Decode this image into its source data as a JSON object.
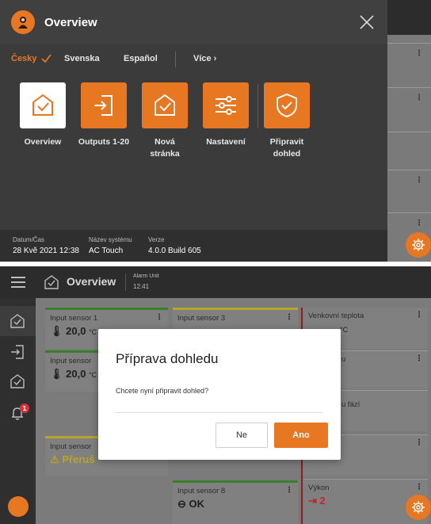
{
  "menu": {
    "title": "Overview",
    "languages": [
      {
        "label": "Česky",
        "selected": true
      },
      {
        "label": "Svenska"
      },
      {
        "label": "Español"
      },
      {
        "label": "Více  ›"
      }
    ],
    "tiles": [
      {
        "label": "Overview",
        "active": true
      },
      {
        "label": "Outputs 1-20"
      },
      {
        "label": "Nová\nstránka"
      },
      {
        "label": "Nastavení"
      },
      {
        "label": "Připravit\ndohled"
      }
    ],
    "footer": {
      "datetime_label": "Datum/Čas",
      "datetime_value": "28 Kvě 2021 12:38",
      "system_label": "Název systému",
      "system_value": "AC Touch",
      "version_label": "Verze",
      "version_value": "4.0.0 Build 605"
    }
  },
  "header": {
    "title": "Overview",
    "alarm_label": "Alarm Unit",
    "alarm_time": "12:41"
  },
  "sidebar": {
    "badge_count": "1"
  },
  "cards": {
    "c1": {
      "title": "Input sensor 1",
      "value": "20,0",
      "unit": "°C"
    },
    "c2": {
      "title": "Input sensor",
      "value": "20,0",
      "unit": "°C"
    },
    "c3": {
      "title": "Input sensor 3"
    },
    "c4": {
      "title": "Venkovní teplota",
      "unit": "°C"
    },
    "c5": {
      "title": "u"
    },
    "c6": {
      "title": "u fází"
    },
    "c7": {
      "title": "Input sensor",
      "value": "Přeruš"
    },
    "c8": {
      "title": "Input sensor 8",
      "value": "OK"
    },
    "c9": {
      "title": "Výkon",
      "value": "2"
    }
  },
  "dialog": {
    "title": "Příprava dohledu",
    "message": "Chcete nyní připravit dohled?",
    "no_label": "Ne",
    "yes_label": "Ano"
  },
  "colors": {
    "accent": "#e87722",
    "dark": "#2c2c2c",
    "alarm_red": "#d9323a",
    "green": "#3a7d2a",
    "yellow": "#b7a42a"
  }
}
